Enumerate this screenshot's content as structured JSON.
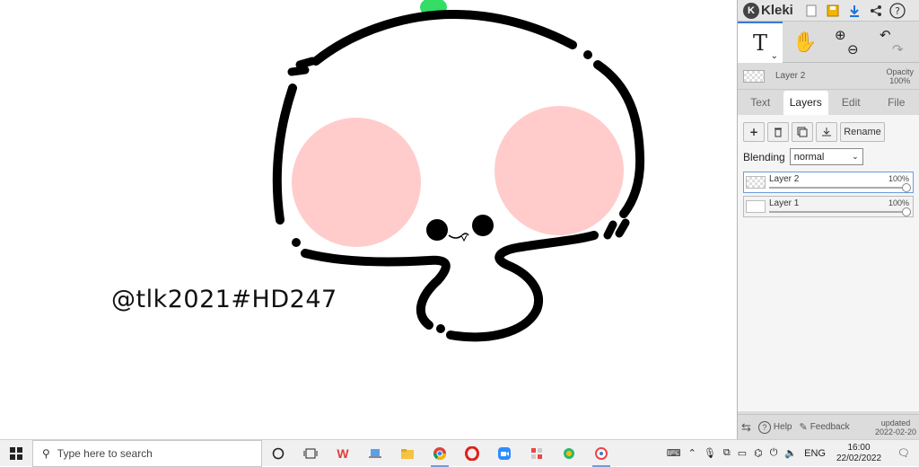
{
  "canvas": {
    "watermark": "@tlk2021#HD247"
  },
  "app": {
    "name": "Kleki",
    "top_icons": [
      "new-file-icon",
      "save-icon",
      "download-icon",
      "share-icon",
      "help-icon"
    ],
    "help_glyph": "?"
  },
  "tools": {
    "text_tool_glyph": "T",
    "hand_tool_glyph": "✋",
    "zoom_in_glyph": "⊕",
    "zoom_out_glyph": "⊖",
    "undo_glyph": "↶",
    "redo_glyph": "↷"
  },
  "layer_info": {
    "name": "Layer 2",
    "opacity_label": "Opacity",
    "opacity_value": "100%"
  },
  "tabs": [
    {
      "label": "Text"
    },
    {
      "label": "Layers",
      "active": true
    },
    {
      "label": "Edit"
    },
    {
      "label": "File"
    }
  ],
  "layers_panel": {
    "rename_label": "Rename",
    "blending_label": "Blending",
    "blending_value": "normal",
    "layers": [
      {
        "name": "Layer 2",
        "opacity": "100%",
        "selected": true
      },
      {
        "name": "Layer 1",
        "opacity": "100%",
        "selected": false
      }
    ]
  },
  "bottom": {
    "help_label": "Help",
    "feedback_label": "Feedback",
    "updated_label": "updated",
    "updated_date": "2022-02-20"
  },
  "taskbar": {
    "search_placeholder": "Type here to search",
    "language": "ENG",
    "time": "16:00",
    "date": "22/02/2022"
  },
  "colors": {
    "cheek": "#ffcccb",
    "sprout": "#33dd66",
    "accent": "#3a7bd5"
  }
}
